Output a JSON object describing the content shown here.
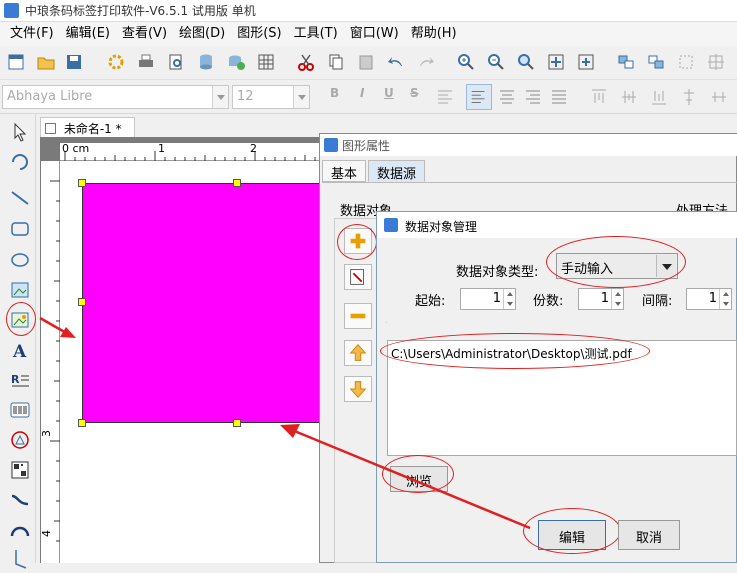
{
  "app": {
    "title": "中琅条码标签打印软件-V6.5.1 试用版 单机"
  },
  "menu": [
    "文件(F)",
    "编辑(E)",
    "查看(V)",
    "绘图(D)",
    "图形(S)",
    "工具(T)",
    "窗口(W)",
    "帮助(H)"
  ],
  "format_bar": {
    "font": "Abhaya Libre",
    "size": "12",
    "bold": "B",
    "italic": "I",
    "underline": "U",
    "strike": "S"
  },
  "document": {
    "tab": "未命名-1 *",
    "ruler_top": [
      "0 cm",
      "1",
      "2"
    ],
    "ruler_left": [
      "3",
      "4"
    ]
  },
  "shape_colors": {
    "fill": "#ff00ff",
    "handles": "#ffff00"
  },
  "props": {
    "title": "图形属性",
    "tabs": [
      "基本",
      "数据源"
    ],
    "data_object_label": "数据对象",
    "process_label": "处理方法"
  },
  "dialog": {
    "title": "数据对象管理",
    "type_label": "数据对象类型:",
    "type_value": "手动输入",
    "start_label": "起始:",
    "start_value": "1",
    "copies_label": "份数:",
    "copies_value": "1",
    "interval_label": "间隔:",
    "interval_value": "1",
    "content": "C:\\Users\\Administrator\\Desktop\\测试.pdf",
    "browse_label": "浏览",
    "edit_label": "编辑",
    "cancel_label": "取消"
  }
}
